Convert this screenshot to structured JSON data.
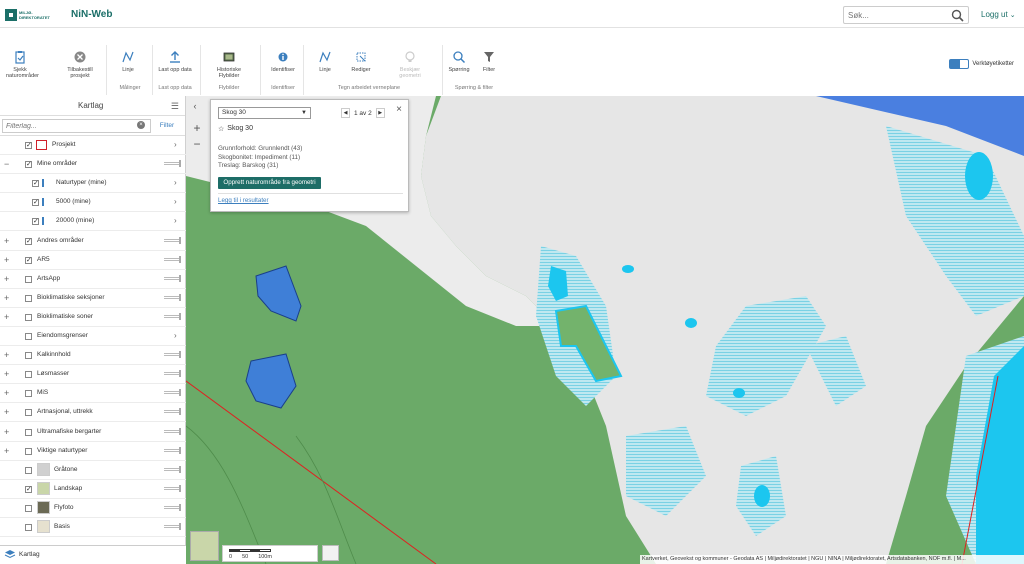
{
  "topbar": {
    "app_title": "NiN-Web",
    "logo_text": "MILJØ-\nDIREKTORATET",
    "search_placeholder": "Søk...",
    "logout_label": "Logg ut"
  },
  "ribbon": {
    "toggle_label": "Verktøyetiketter",
    "buttons": [
      {
        "label": "Sjekk\nnaturområder"
      },
      {
        "label": "Tilbakestill\nprosjekt"
      },
      {
        "label": "Linje"
      },
      {
        "label": "Last opp data"
      },
      {
        "label": "Historiske\nFlybilder"
      },
      {
        "label": "Identifiser"
      },
      {
        "label": "Linje"
      },
      {
        "label": "Rediger"
      },
      {
        "label": "Beskjær\ngeometri"
      },
      {
        "label": "Spørring"
      },
      {
        "label": "Filter"
      }
    ],
    "groups": [
      "Målinger",
      "Last opp data",
      "Flybilder",
      "Identifiser",
      "Tegn arbeidet verneplane",
      "Spørring & filter"
    ]
  },
  "sidebar": {
    "title": "Kartlag",
    "filter_placeholder": "Filterlag...",
    "filter_button": "Filter",
    "layers": [
      {
        "label": "Prosjekt",
        "checked": true
      },
      {
        "label": "Mine områder",
        "checked": true
      },
      {
        "label": "Naturtyper (mine)",
        "checked": true
      },
      {
        "label": "5000 (mine)",
        "checked": true
      },
      {
        "label": "20000 (mine)",
        "checked": true
      },
      {
        "label": "Andres områder",
        "checked": true
      },
      {
        "label": "AR5",
        "checked": true
      },
      {
        "label": "ArtsApp",
        "checked": false
      },
      {
        "label": "Bioklimatiske seksjoner",
        "checked": false
      },
      {
        "label": "Bioklimatiske soner",
        "checked": false
      },
      {
        "label": "Eiendomsgrenser",
        "checked": false
      },
      {
        "label": "Kalkinnhold",
        "checked": false
      },
      {
        "label": "Løsmasser",
        "checked": false
      },
      {
        "label": "MiS",
        "checked": false
      },
      {
        "label": "Artnasjonal, uttrekk",
        "checked": false
      },
      {
        "label": "Ultramafiske bergarter",
        "checked": false
      },
      {
        "label": "Viktige naturtyper",
        "checked": false
      },
      {
        "label": "Gråtone",
        "checked": false
      },
      {
        "label": "Landskap",
        "checked": true
      },
      {
        "label": "Flyfoto",
        "checked": false
      },
      {
        "label": "Basis",
        "checked": false
      }
    ],
    "bottom_tab": "Kartlag"
  },
  "popup": {
    "selected": "Skog 30",
    "pager": "1 av 2",
    "title": "Skog 30",
    "lines": [
      "Grunnforhold: Grunnlendt (43)",
      "Skogbonitet: Impediment (11)",
      "Treslag: Barskog (31)"
    ],
    "cta": "Opprett naturområde fra geometri",
    "link": "Legg til i resultater"
  },
  "scale": {
    "labels": [
      "0",
      "50",
      "100m"
    ]
  },
  "attribution": "Kartverket, Geovekst og kommuner - Geodata AS | Miljødirektoratet | NGU | NINA | Miljødirektoratet, Artsdatabanken, NOF m.fl. | M..."
}
